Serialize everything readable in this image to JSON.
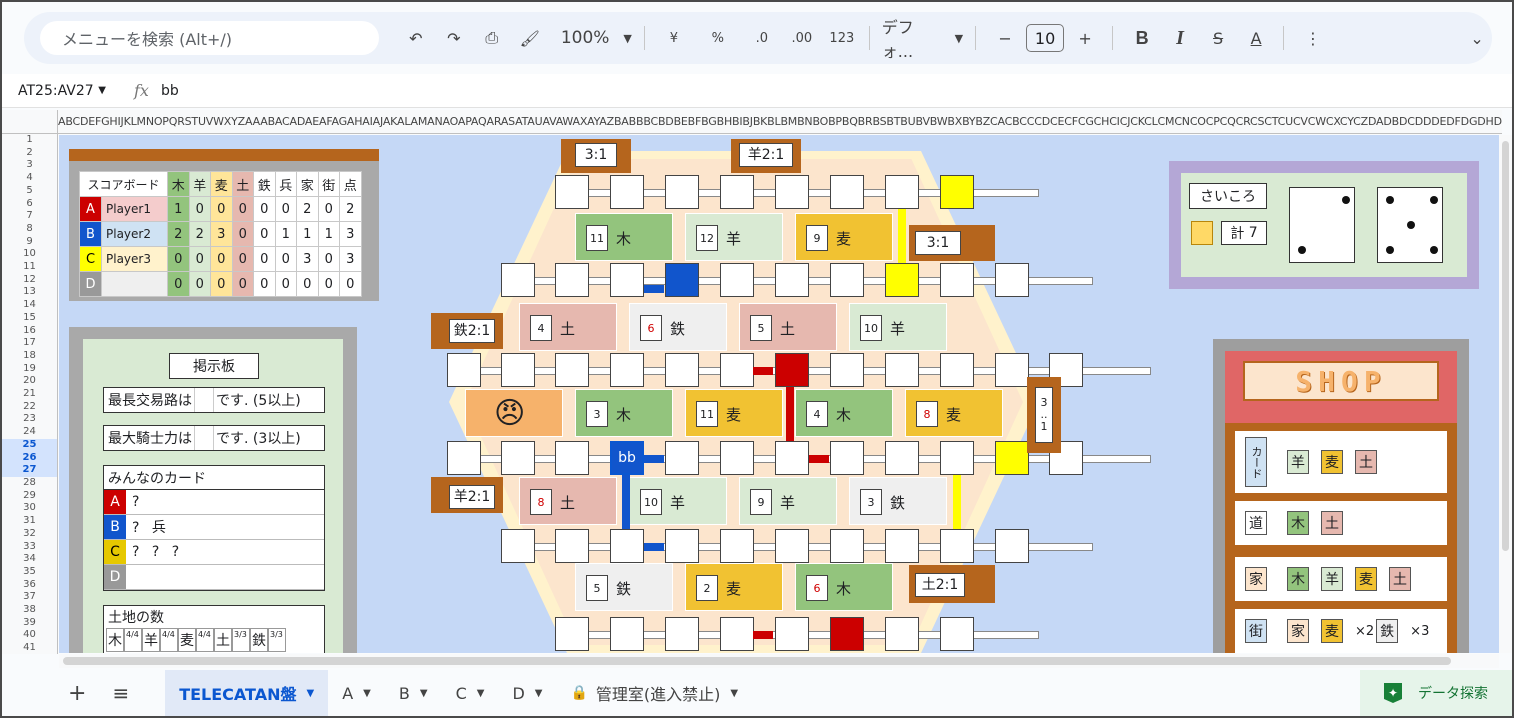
{
  "toolbar": {
    "search_placeholder": "メニューを検索 (Alt+/)",
    "zoom": "100%",
    "currency": "¥",
    "percent": "%",
    "dec_less": ".0",
    "dec_more": ".00",
    "format_num": "123",
    "font": "デフォ...",
    "font_size": "10",
    "bold": "B",
    "italic": "I",
    "strike": "S",
    "text_color": "A"
  },
  "formula_bar": {
    "name_box": "AT25:AV27",
    "fx": "fx",
    "value": "bb"
  },
  "column_header": "ABCDEFGHIJKLMNOPQRSTUVWXYZAAABACADAEAFAGAHAIAJAKALAMANAOAPAQARASATAUAVAWAXAYAZBABBBCBDBEBFBGBHBIBJBKBLBMBNBOBPBQBRBSBTBUBVBWBXBYBZCACBCCCDCECFCGCHCICJCKCLCMCNCOCPCQCRCSCTCUCVCWCXCYCZDADBDCDDDEDFDGDHDIDJDKDLDMDNDODPDQDRDSDTDUDVDWDXDYDZEA",
  "rows": [
    "1",
    "2",
    "3",
    "4",
    "5",
    "6",
    "7",
    "8",
    "9",
    "10",
    "11",
    "12",
    "13",
    "14",
    "15",
    "16",
    "17",
    "18",
    "19",
    "20",
    "21",
    "22",
    "23",
    "24",
    "25",
    "26",
    "27",
    "28",
    "29",
    "30",
    "31",
    "32",
    "33",
    "34",
    "35",
    "36",
    "37",
    "38",
    "39",
    "40",
    "41"
  ],
  "scoreboard": {
    "title": "スコアボード",
    "headers": [
      "木",
      "羊",
      "麦",
      "土",
      "鉄",
      "兵",
      "家",
      "街",
      "点"
    ],
    "players": [
      {
        "label": "A",
        "name": "Player1",
        "color": "#cc0000",
        "bg": "#f4cccc",
        "values": [
          "1",
          "0",
          "0",
          "0",
          "0",
          "0",
          "2",
          "0",
          "2"
        ]
      },
      {
        "label": "B",
        "name": "Player2",
        "color": "#1155cc",
        "bg": "#cfe2f3",
        "values": [
          "2",
          "2",
          "3",
          "0",
          "0",
          "1",
          "1",
          "1",
          "3"
        ]
      },
      {
        "label": "C",
        "name": "Player3",
        "color": "#ffff00",
        "bg": "#fff2cc",
        "values": [
          "0",
          "0",
          "0",
          "0",
          "0",
          "0",
          "3",
          "0",
          "3"
        ]
      },
      {
        "label": "D",
        "name": "",
        "color": "#999999",
        "bg": "#efefef",
        "values": [
          "0",
          "0",
          "0",
          "0",
          "0",
          "0",
          "0",
          "0",
          "0"
        ]
      }
    ]
  },
  "notice": {
    "title": "掲示板",
    "longest_road": "最長交易路は",
    "longest_suffix": "です. (5以上)",
    "largest_army": "最大騎士力は",
    "army_suffix": "です. (3以上)",
    "cards_title": "みんなのカード",
    "cards": [
      {
        "label": "A",
        "color": "#cc0000",
        "text": "?"
      },
      {
        "label": "B",
        "color": "#1155cc",
        "text": "? 兵"
      },
      {
        "label": "C",
        "color": "#e6c800",
        "text": "? ? ?"
      },
      {
        "label": "D",
        "color": "#999999",
        "text": ""
      }
    ],
    "land_title": "土地の数",
    "land": [
      "木",
      "4/4",
      "羊",
      "4/4",
      "麦",
      "4/4",
      "土",
      "3/3",
      "鉄",
      "3/3"
    ]
  },
  "map": {
    "tiles": [
      {
        "n": "11",
        "name": "木",
        "c": "#93c47d",
        "red": false
      },
      {
        "n": "12",
        "name": "羊",
        "c": "#d9ead3",
        "red": false
      },
      {
        "n": "9",
        "name": "麦",
        "c": "#f1c232",
        "red": false
      },
      {
        "n": "4",
        "name": "土",
        "c": "#e6b8af",
        "red": false
      },
      {
        "n": "6",
        "name": "鉄",
        "c": "#efefef",
        "red": true
      },
      {
        "n": "5",
        "name": "土",
        "c": "#e6b8af",
        "red": false
      },
      {
        "n": "10",
        "name": "羊",
        "c": "#d9ead3",
        "red": false
      },
      {
        "n": "",
        "name": "",
        "c": "#f6b26b",
        "red": false
      },
      {
        "n": "3",
        "name": "木",
        "c": "#93c47d",
        "red": false
      },
      {
        "n": "11",
        "name": "麦",
        "c": "#f1c232",
        "red": false
      },
      {
        "n": "4",
        "name": "木",
        "c": "#93c47d",
        "red": false
      },
      {
        "n": "8",
        "name": "麦",
        "c": "#f1c232",
        "red": true
      },
      {
        "n": "8",
        "name": "土",
        "c": "#e6b8af",
        "red": true
      },
      {
        "n": "10",
        "name": "羊",
        "c": "#d9ead3",
        "red": false
      },
      {
        "n": "9",
        "name": "羊",
        "c": "#d9ead3",
        "red": false
      },
      {
        "n": "3",
        "name": "鉄",
        "c": "#efefef",
        "red": false
      },
      {
        "n": "5",
        "name": "鉄",
        "c": "#efefef",
        "red": false
      },
      {
        "n": "2",
        "name": "麦",
        "c": "#f1c232",
        "red": false
      },
      {
        "n": "6",
        "name": "木",
        "c": "#93c47d",
        "red": true
      }
    ],
    "ports": [
      "3:1",
      "羊2:1",
      "3:1",
      "鉄2:1",
      "3\n..\n1",
      "羊2:1",
      "土2:1"
    ],
    "selected": "bb"
  },
  "dice": {
    "label": "さいころ",
    "total_label": "計",
    "total": "7"
  },
  "shop": {
    "sign": "SHOP",
    "rows": [
      [
        "カード",
        "羊",
        "麦",
        "土"
      ],
      [
        "道",
        "木",
        "土"
      ],
      [
        "家",
        "木",
        "羊",
        "麦",
        "土"
      ],
      [
        "街",
        "家",
        "麦",
        "×2",
        "鉄",
        "×3"
      ]
    ]
  },
  "tabs": [
    "TELECATAN盤",
    "A",
    "B",
    "C",
    "D",
    "管理室(進入禁止)"
  ],
  "explore": "データ探索"
}
